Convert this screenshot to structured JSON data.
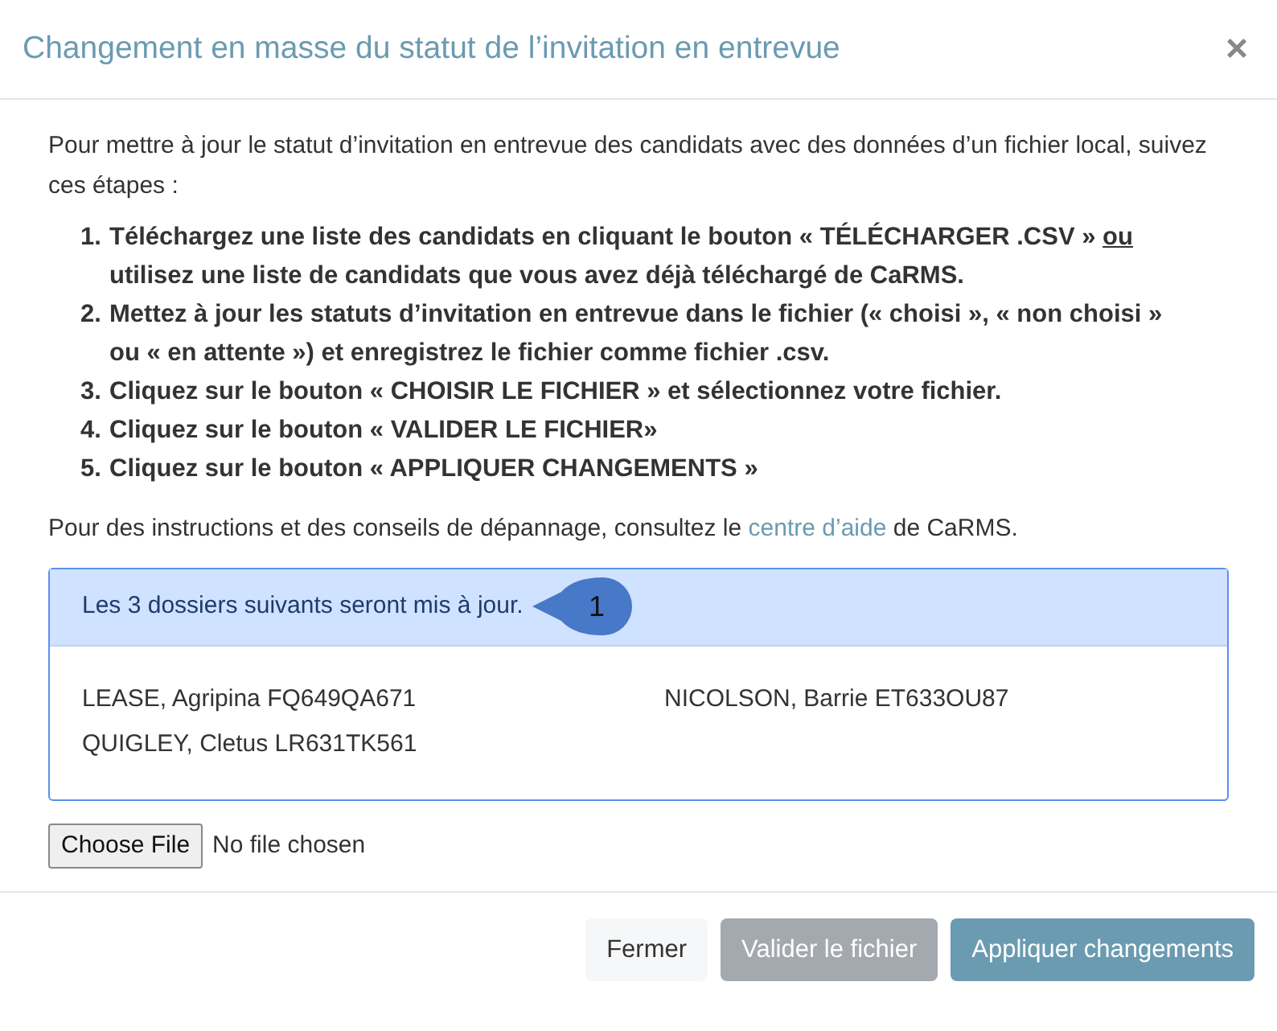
{
  "modal": {
    "title": "Changement en masse du statut de l’invitation en entrevue",
    "close": "×"
  },
  "intro": "Pour mettre à jour le statut d’invitation en entrevue des candidats avec des données d’un fichier local, suivez ces étapes :",
  "steps": [
    {
      "marker": "1.",
      "parts": [
        {
          "text": "Téléchargez une liste des candidats en cliquant le bouton « TÉLÉCHARGER .CSV » ",
          "underline": false
        },
        {
          "text": "ou",
          "underline": true
        },
        {
          "text": " utilisez une liste de candidats que vous avez déjà téléchargé de CaRMS.",
          "underline": false
        }
      ]
    },
    {
      "marker": "2.",
      "parts": [
        {
          "text": "Mettez à jour les statuts d’invitation en entrevue dans le fichier (« choisi », « non choisi » ou « en attente ») et enregistrez le fichier comme fichier .csv.",
          "underline": false
        }
      ]
    },
    {
      "marker": "3.",
      "parts": [
        {
          "text": "Cliquez sur le bouton « CHOISIR LE FICHIER » et sélectionnez votre fichier.",
          "underline": false
        }
      ]
    },
    {
      "marker": "4.",
      "parts": [
        {
          "text": "Cliquez sur le bouton « VALIDER LE FICHIER»",
          "underline": false
        }
      ]
    },
    {
      "marker": "5.",
      "parts": [
        {
          "text": "Cliquez sur le bouton « APPLIQUER CHANGEMENTS »",
          "underline": false
        }
      ]
    }
  ],
  "help": {
    "before": "Pour des instructions et des conseils de dépannage, consultez le ",
    "link": "centre d’aide",
    "after": " de CaRMS."
  },
  "records_panel": {
    "heading": "Les 3 dossiers suivants seront mis à jour.",
    "callout": "1",
    "records": [
      "LEASE, Agripina FQ649QA671",
      "NICOLSON, Barrie ET633OU87",
      "QUIGLEY, Cletus LR631TK561"
    ]
  },
  "file_input": {
    "button": "Choose File",
    "status": "No file chosen"
  },
  "buttons": [
    {
      "label": "Fermer",
      "kind": "light",
      "disabled": false
    },
    {
      "label": "Valider le fichier",
      "kind": "secondary",
      "disabled": true
    },
    {
      "label": "Appliquer changements",
      "kind": "primary",
      "disabled": false
    }
  ]
}
